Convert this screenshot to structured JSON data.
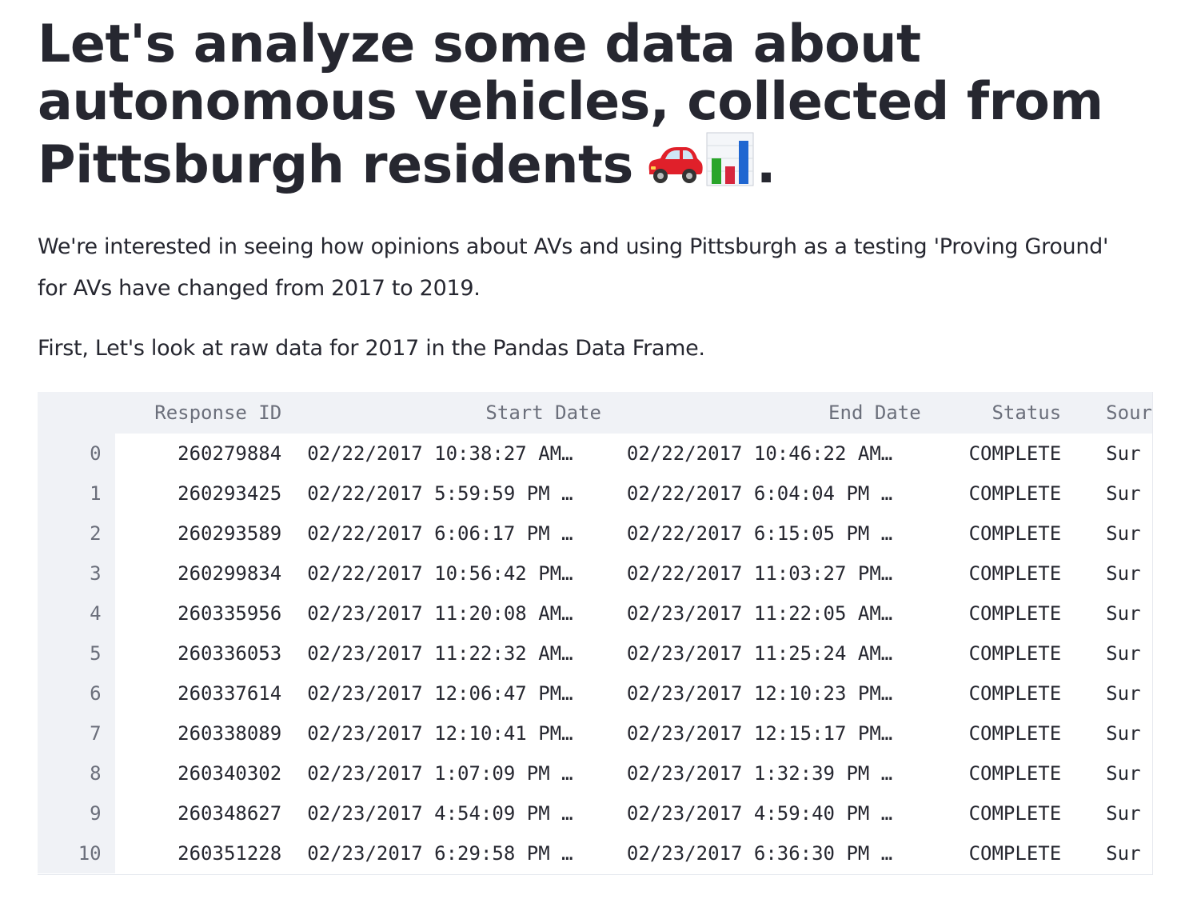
{
  "title": {
    "line1": "Let's analyze some data about",
    "line2": "autonomous vehicles, collected from",
    "line3": "Pittsburgh residents",
    "period": ".",
    "emojis": [
      "car-emoji",
      "bar-chart-emoji"
    ]
  },
  "intro": "We're interested in seeing how opinions about AVs and using Pittsburgh as a testing 'Proving Ground' for AVs have changed from 2017 to 2019.",
  "lead": "First, Let's look at raw data for 2017 in the Pandas Data Frame.",
  "dataframe": {
    "columns": [
      "Response ID",
      "Start Date",
      "End Date",
      "Status",
      "Sour"
    ],
    "rows": [
      {
        "index": "0",
        "response_id": "260279884",
        "start_date": "02/22/2017 10:38:27 AM…",
        "end_date": "02/22/2017 10:46:22 AM…",
        "status": "COMPLETE",
        "source": "Sur"
      },
      {
        "index": "1",
        "response_id": "260293425",
        "start_date": "02/22/2017 5:59:59 PM …",
        "end_date": "02/22/2017 6:04:04 PM …",
        "status": "COMPLETE",
        "source": "Sur"
      },
      {
        "index": "2",
        "response_id": "260293589",
        "start_date": "02/22/2017 6:06:17 PM …",
        "end_date": "02/22/2017 6:15:05 PM …",
        "status": "COMPLETE",
        "source": "Sur"
      },
      {
        "index": "3",
        "response_id": "260299834",
        "start_date": "02/22/2017 10:56:42 PM…",
        "end_date": "02/22/2017 11:03:27 PM…",
        "status": "COMPLETE",
        "source": "Sur"
      },
      {
        "index": "4",
        "response_id": "260335956",
        "start_date": "02/23/2017 11:20:08 AM…",
        "end_date": "02/23/2017 11:22:05 AM…",
        "status": "COMPLETE",
        "source": "Sur"
      },
      {
        "index": "5",
        "response_id": "260336053",
        "start_date": "02/23/2017 11:22:32 AM…",
        "end_date": "02/23/2017 11:25:24 AM…",
        "status": "COMPLETE",
        "source": "Sur"
      },
      {
        "index": "6",
        "response_id": "260337614",
        "start_date": "02/23/2017 12:06:47 PM…",
        "end_date": "02/23/2017 12:10:23 PM…",
        "status": "COMPLETE",
        "source": "Sur"
      },
      {
        "index": "7",
        "response_id": "260338089",
        "start_date": "02/23/2017 12:10:41 PM…",
        "end_date": "02/23/2017 12:15:17 PM…",
        "status": "COMPLETE",
        "source": "Sur"
      },
      {
        "index": "8",
        "response_id": "260340302",
        "start_date": "02/23/2017 1:07:09 PM …",
        "end_date": "02/23/2017 1:32:39 PM …",
        "status": "COMPLETE",
        "source": "Sur"
      },
      {
        "index": "9",
        "response_id": "260348627",
        "start_date": "02/23/2017 4:54:09 PM …",
        "end_date": "02/23/2017 4:59:40 PM …",
        "status": "COMPLETE",
        "source": "Sur"
      },
      {
        "index": "10",
        "response_id": "260351228",
        "start_date": "02/23/2017 6:29:58 PM …",
        "end_date": "02/23/2017 6:36:30 PM …",
        "status": "COMPLETE",
        "source": "Sur"
      }
    ]
  },
  "colors": {
    "text": "#262730",
    "muted": "#6b6f7b",
    "header_bg": "#f0f2f6",
    "car_red": "#e0202a",
    "bar_green": "#2aa52a",
    "bar_red": "#d7263d",
    "bar_blue": "#1f66d1"
  }
}
